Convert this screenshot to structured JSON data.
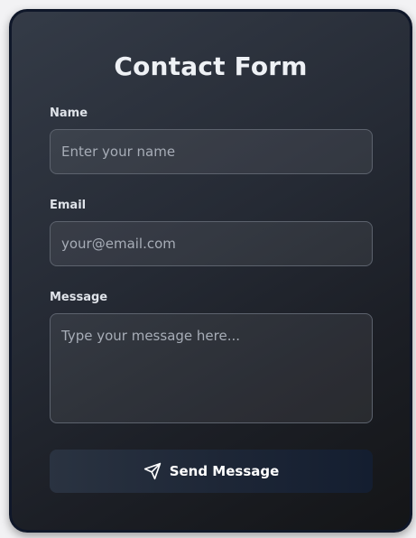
{
  "form": {
    "title": "Contact Form",
    "fields": {
      "name": {
        "label": "Name",
        "placeholder": "Enter your name",
        "value": ""
      },
      "email": {
        "label": "Email",
        "placeholder": "your@email.com",
        "value": ""
      },
      "message": {
        "label": "Message",
        "placeholder": "Type your message here...",
        "value": ""
      }
    },
    "submit": {
      "label": "Send Message",
      "icon": "send-icon"
    }
  },
  "colors": {
    "card_border": "#0f1729",
    "button_start": "#2a3341",
    "button_end": "#141e30"
  }
}
